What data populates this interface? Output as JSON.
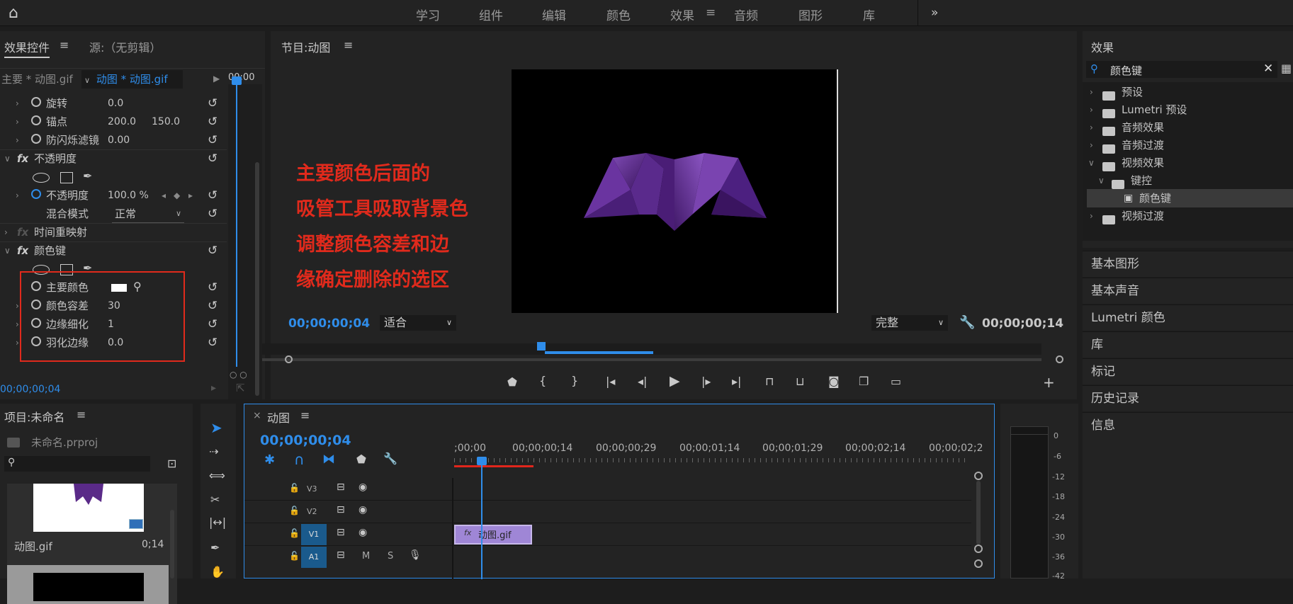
{
  "topbar": {
    "workspaces": [
      "学习",
      "组件",
      "编辑",
      "颜色",
      "效果",
      "音频",
      "图形",
      "库"
    ],
    "active": "效果",
    "more": "»"
  },
  "effect_controls": {
    "tab_label": "效果控件",
    "menu": "≡",
    "source_label": "源:（无剪辑）",
    "master_clip": "主要 * 动图.gif",
    "sequence_clip": "动图 * 动图.gif",
    "mini_time": "00;00",
    "rows": {
      "rotation": {
        "label": "旋转",
        "value": "0.0"
      },
      "anchor": {
        "label": "锚点",
        "x": "200.0",
        "y": "150.0"
      },
      "flicker": {
        "label": "防闪烁滤镜",
        "value": "0.00"
      },
      "opacity_group": "不透明度",
      "opacity": {
        "label": "不透明度",
        "value": "100.0 %"
      },
      "blend": {
        "label": "混合模式",
        "value": "正常"
      },
      "time_remap": "时间重映射",
      "color_key": "颜色键",
      "key_color": {
        "label": "主要颜色"
      },
      "tolerance": {
        "label": "颜色容差",
        "value": "30"
      },
      "edge_thin": {
        "label": "边缘细化",
        "value": "1"
      },
      "feather": {
        "label": "羽化边缘",
        "value": "0.0"
      }
    },
    "bottom_time": "00;00;00;04"
  },
  "program": {
    "title": "节目:动图",
    "menu": "≡",
    "annotation": [
      "主要颜色后面的",
      "吸管工具吸取背景色",
      "调整颜色容差和边",
      "缘确定删除的选区"
    ],
    "current_time": "00;00;00;04",
    "fit": "适合",
    "quality": "完整",
    "duration": "00;00;00;14",
    "colors": {
      "annotation": "#e02a1c",
      "accent": "#2f8dea",
      "bat": "#5a2a88"
    }
  },
  "effects_panel": {
    "title": "效果",
    "search": "颜色键",
    "tree": [
      "预设",
      "Lumetri 预设",
      "音频效果",
      "音频过渡",
      "视频效果",
      "键控",
      "颜色键",
      "视频过渡"
    ],
    "other_panels": [
      "基本图形",
      "基本声音",
      "Lumetri 颜色",
      "库",
      "标记",
      "历史记录",
      "信息"
    ]
  },
  "project": {
    "title": "项目:未命名",
    "menu": "≡",
    "file": "未命名.prproj",
    "item_name": "动图.gif",
    "item_duration": "0;14"
  },
  "timeline": {
    "title": "动图",
    "menu": "≡",
    "close": "×",
    "timecode": "00;00;00;04",
    "ruler": [
      ";00;00",
      "00;00;00;14",
      "00;00;00;29",
      "00;00;01;14",
      "00;00;01;29",
      "00;00;02;14",
      "00;00;02;2"
    ],
    "tracks": [
      "V3",
      "V2",
      "V1",
      "A1"
    ],
    "clip": "动图.gif",
    "clip_fx": "fx",
    "audio_m": "M",
    "audio_s": "S"
  },
  "meter": {
    "labels": [
      "0",
      "-6",
      "-12",
      "-18",
      "-24",
      "-30",
      "-36",
      "-42"
    ]
  }
}
